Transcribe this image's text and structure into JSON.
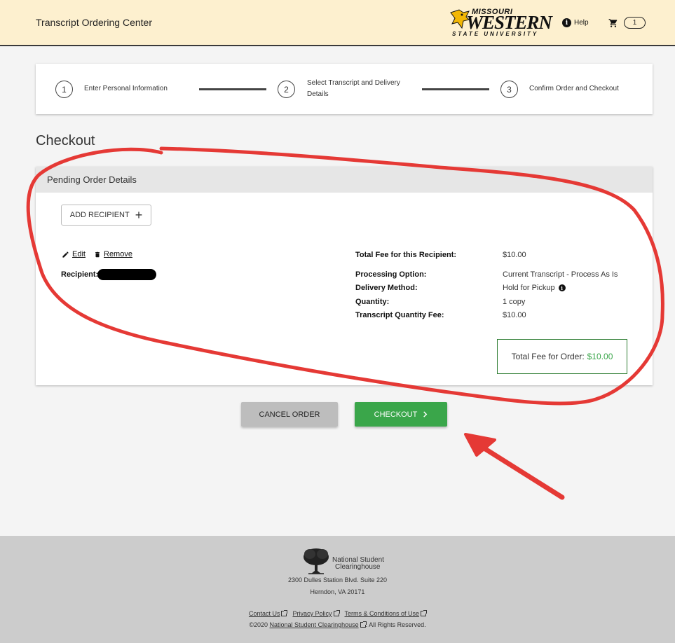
{
  "header": {
    "app_title": "Transcript Ordering Center",
    "logo": {
      "line1": "MISSOURI",
      "line2": "WESTERN",
      "line3": "STATE UNIVERSITY"
    },
    "help_label": "Help",
    "cart_count": "1"
  },
  "stepper": {
    "steps": [
      {
        "number": "1",
        "label": "Enter Personal Information"
      },
      {
        "number": "2",
        "label": "Select Transcript and Delivery Details"
      },
      {
        "number": "3",
        "label": "Confirm Order and Checkout"
      }
    ]
  },
  "page_title": "Checkout",
  "order": {
    "header": "Pending Order Details",
    "add_recipient_label": "ADD RECIPIENT",
    "edit_label": "Edit",
    "remove_label": "Remove",
    "recipient_label": "Recipient:",
    "details": [
      {
        "key": "Total Fee for this Recipient:",
        "value": "$10.00"
      },
      {
        "key": "Processing Option:",
        "value": "Current Transcript - Process As Is"
      },
      {
        "key": "Delivery Method:",
        "value": "Hold for Pickup"
      },
      {
        "key": "Quantity:",
        "value": "1 copy"
      },
      {
        "key": "Transcript Quantity Fee:",
        "value": "$10.00"
      }
    ],
    "total_label": "Total Fee for Order:",
    "total_amount": "$10.00"
  },
  "actions": {
    "cancel_label": "CANCEL ORDER",
    "checkout_label": "CHECKOUT"
  },
  "footer": {
    "org_line1": "National Student",
    "org_line2": "Clearinghouse",
    "address_line1": "2300 Dulles Station Blvd. Suite 220",
    "address_line2": "Herndon, VA 20171",
    "links": [
      "Contact Us",
      "Privacy Policy",
      "Terms & Conditions of Use"
    ],
    "copyright_prefix": "©2020",
    "copyright_link": "National Student Clearinghouse",
    "copyright_suffix": ". All Rights Reserved."
  },
  "colors": {
    "header_bg": "#fdf0cf",
    "accent_green": "#3aa64a",
    "cancel_gray": "#bdbdbd",
    "annotation_red": "#e53935"
  }
}
